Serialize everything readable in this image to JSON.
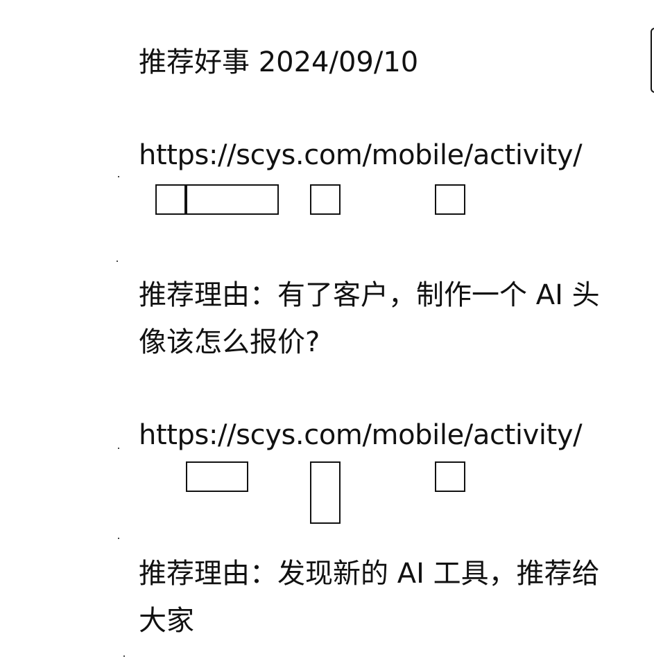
{
  "post": {
    "heading": "推荐好事 2024/09/10",
    "items": [
      {
        "link_text": "https://scys.com/mobile/activity/",
        "reason": "推荐理由：有了客户，制作一个 AI 头像该怎么报价?"
      },
      {
        "link_text": "https://scys.com/mobile/activity/",
        "reason": "推荐理由：发现新的 AI 工具，推荐给大家"
      }
    ]
  }
}
